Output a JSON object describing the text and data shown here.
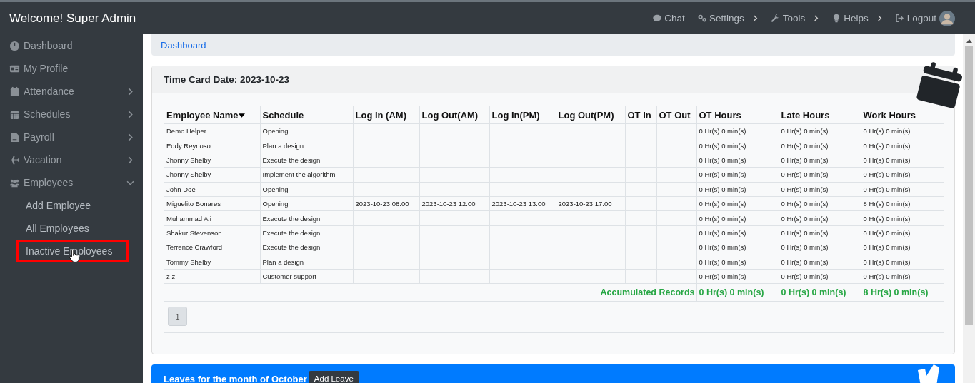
{
  "topbar": {
    "title": "Welcome! Super Admin",
    "nav": [
      {
        "label": "Chat",
        "kind": "link"
      },
      {
        "label": "Settings",
        "kind": "menu"
      },
      {
        "label": "Tools",
        "kind": "menu"
      },
      {
        "label": "Helps",
        "kind": "menu"
      },
      {
        "label": "Logout",
        "kind": "link"
      }
    ]
  },
  "sidebar": {
    "items": [
      {
        "label": "Dashboard"
      },
      {
        "label": "My Profile"
      },
      {
        "label": "Attendance",
        "expanded": false
      },
      {
        "label": "Schedules",
        "expanded": false
      },
      {
        "label": "Payroll",
        "expanded": false
      },
      {
        "label": "Vacation",
        "expanded": false
      },
      {
        "label": "Employees",
        "expanded": true,
        "children": [
          {
            "label": "Add Employee",
            "selected": false
          },
          {
            "label": "All Employees",
            "selected": false
          },
          {
            "label": "Inactive Employees",
            "selected": true
          }
        ]
      }
    ]
  },
  "breadcrumb": "Dashboard",
  "time_card": {
    "title": "Time Card Date: 2023-10-23",
    "columns": [
      "Employee Name",
      "Schedule",
      "Log In (AM)",
      "Log Out(AM)",
      "Log In(PM)",
      "Log Out(PM)",
      "OT In",
      "OT Out",
      "OT Hours",
      "Late Hours",
      "Work Hours"
    ],
    "rows": [
      [
        "Demo Helper",
        "Opening",
        null,
        null,
        null,
        null,
        null,
        null,
        "0 Hr(s) 0 min(s)",
        "0 Hr(s) 0 min(s)",
        "0 Hr(s) 0 min(s)"
      ],
      [
        "Eddy Reynoso",
        "Plan a design",
        null,
        null,
        null,
        null,
        null,
        null,
        "0 Hr(s) 0 min(s)",
        "0 Hr(s) 0 min(s)",
        "0 Hr(s) 0 min(s)"
      ],
      [
        "Jhonny Shelby",
        "Execute the design",
        null,
        null,
        null,
        null,
        null,
        null,
        "0 Hr(s) 0 min(s)",
        "0 Hr(s) 0 min(s)",
        "0 Hr(s) 0 min(s)"
      ],
      [
        "Jhonny Shelby",
        "Implement the algorithm",
        null,
        null,
        null,
        null,
        null,
        null,
        "0 Hr(s) 0 min(s)",
        "0 Hr(s) 0 min(s)",
        "0 Hr(s) 0 min(s)"
      ],
      [
        "John Doe",
        "Opening",
        null,
        null,
        null,
        null,
        null,
        null,
        "0 Hr(s) 0 min(s)",
        "0 Hr(s) 0 min(s)",
        "0 Hr(s) 0 min(s)"
      ],
      [
        "Miguelito Bonares",
        "Opening",
        "2023-10-23 08:00",
        "2023-10-23 12:00",
        "2023-10-23 13:00",
        "2023-10-23 17:00",
        null,
        null,
        "0 Hr(s) 0 min(s)",
        "0 Hr(s) 0 min(s)",
        "8 Hr(s) 0 min(s)"
      ],
      [
        "Muhammad Ali",
        "Execute the design",
        null,
        null,
        null,
        null,
        null,
        null,
        "0 Hr(s) 0 min(s)",
        "0 Hr(s) 0 min(s)",
        "0 Hr(s) 0 min(s)"
      ],
      [
        "Shakur Stevenson",
        "Execute the design",
        null,
        null,
        null,
        null,
        null,
        null,
        "0 Hr(s) 0 min(s)",
        "0 Hr(s) 0 min(s)",
        "0 Hr(s) 0 min(s)"
      ],
      [
        "Terrence Crawford",
        "Execute the design",
        null,
        null,
        null,
        null,
        null,
        null,
        "0 Hr(s) 0 min(s)",
        "0 Hr(s) 0 min(s)",
        "0 Hr(s) 0 min(s)"
      ],
      [
        "Tommy Shelby",
        "Plan a design",
        null,
        null,
        null,
        null,
        null,
        null,
        "0 Hr(s) 0 min(s)",
        "0 Hr(s) 0 min(s)",
        "0 Hr(s) 0 min(s)"
      ],
      [
        "z z",
        "Customer support",
        null,
        null,
        null,
        null,
        null,
        null,
        "0 Hr(s) 0 min(s)",
        "0 Hr(s) 0 min(s)",
        "0 Hr(s) 0 min(s)"
      ]
    ],
    "totals": {
      "label": "Accumulated Records",
      "values": [
        "0 Hr(s) 0 min(s)",
        "0 Hr(s) 0 min(s)",
        "8 Hr(s) 0 min(s)"
      ]
    },
    "pages": [
      {
        "label": "1",
        "selected": true
      }
    ]
  },
  "leaves": {
    "title": "Leaves for the month of October",
    "button": "Add Leave"
  }
}
